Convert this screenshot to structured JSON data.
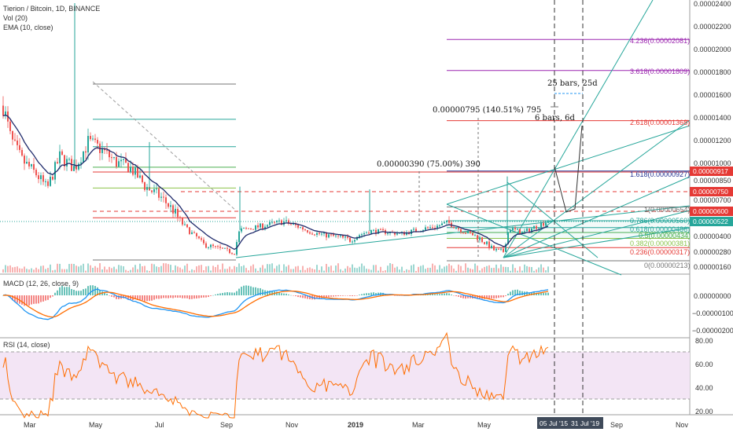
{
  "title": "Tierion / Bitcoin, 1D, BINANCE",
  "legend": [
    "Vol (20)",
    "EMA (10, close)"
  ],
  "colors": {
    "up": "#26a69a",
    "down": "#ef5350",
    "ema": "#1f2a6b",
    "macd": "#2196f3",
    "signal": "#ff6d00",
    "rsi": "#ff6d00",
    "rsi_band": "#f3e5f5"
  },
  "chart_data": [
    {
      "type": "candlestick",
      "title": "Tierion / Bitcoin, 1D, BINANCE",
      "y_scale": "linear",
      "y_ticks": [
        "0.00000160",
        "0.00000280",
        "0.00000400",
        "0.00000560",
        "0.00000700",
        "0.00000850",
        "0.00001000",
        "0.00001200",
        "0.00001400",
        "0.00001600",
        "0.00001800",
        "0.00002000",
        "0.00002200",
        "0.00002400"
      ],
      "x_ticks": [
        "Mar",
        "May",
        "Jul",
        "Sep",
        "Nov",
        "2019",
        "Mar",
        "May",
        "Sep",
        "Nov"
      ],
      "x_ticks_bold": [
        "2019"
      ],
      "x_range_labels": [
        "05 Jul '15",
        "31 Jul '19"
      ],
      "series": [
        {
          "name": "EMA (10, close)",
          "style": "line",
          "values_approx": [
            1.31e-05,
            1.05e-05,
            9e-06,
            8e-06,
            7.5e-06,
            1.15e-05,
            1.08e-05,
            9.2e-06,
            8.2e-06,
            7.4e-06,
            6e-06,
            4.6e-06,
            3.4e-06,
            3e-06,
            4.1e-06,
            4.7e-06,
            4.8e-06,
            4.4e-06,
            3.9e-06,
            3.7e-06,
            3.9e-06,
            4.1e-06,
            4.4e-06,
            4.5e-06,
            4.7e-06,
            4.1e-06,
            3.4e-06,
            3e-06,
            3.8e-06,
            4.8e-06
          ]
        }
      ],
      "close_approx_x": [
        "Feb",
        "Mar",
        "Mar",
        "Apr",
        "Apr",
        "May",
        "May",
        "Jun",
        "Jun",
        "Jul",
        "Jul",
        "Aug",
        "Aug",
        "Sep",
        "Sep",
        "Oct",
        "Oct",
        "Nov",
        "Nov",
        "Dec",
        "Dec",
        "Jan",
        "Jan",
        "Feb",
        "Mar",
        "Apr",
        "Apr",
        "May",
        "Jun",
        "Jul"
      ],
      "price_labels": [
        "0.00000917",
        "0.00000750",
        "0.00000600",
        "0.00000522"
      ],
      "fib_levels": [
        {
          "label": "4.236(0.00002081)",
          "value": 2.081e-05
        },
        {
          "label": "3.618(0.00001809)",
          "value": 1.809e-05
        },
        {
          "label": "2.618(0.00001368)",
          "value": 1.368e-05
        },
        {
          "label": "1.618(0.00000927)",
          "value": 9.27e-06
        },
        {
          "label": "1(0.00000654)",
          "value": 6.54e-06
        },
        {
          "label": "0.786(0.00000560)",
          "value": 5.6e-06
        },
        {
          "label": "0.618(0.00000486)",
          "value": 4.86e-06
        },
        {
          "label": "0.5(0.00000434)",
          "value": 4.34e-06
        },
        {
          "label": "0.382(0.00000381)",
          "value": 3.81e-06
        },
        {
          "label": "0.236(0.00000317)",
          "value": 3.17e-06
        },
        {
          "label": "0(0.00000213)",
          "value": 2.13e-06
        }
      ],
      "annotations": [
        "0.00000795 (140.51%) 795",
        "0.00000390 (75.00%) 390",
        "25 bars, 25d",
        "6 bars, 6d"
      ]
    },
    {
      "type": "line",
      "title": "MACD (12, 26, close, 9)",
      "y_ticks": [
        "0.00000000",
        "−0.00000100",
        "−0.00000200"
      ],
      "series": [
        {
          "name": "MACD"
        },
        {
          "name": "Signal"
        }
      ]
    },
    {
      "type": "line",
      "title": "RSI (14, close)",
      "y_ticks": [
        "80.00",
        "60.00",
        "40.00",
        "20.00"
      ],
      "bands": [
        70,
        30
      ]
    }
  ]
}
